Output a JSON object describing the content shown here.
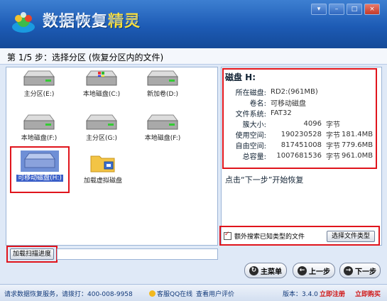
{
  "app": {
    "title_main": "数据恢复",
    "title_highlight": "精灵",
    "window_buttons": [
      "▾",
      "–",
      "□",
      "×"
    ]
  },
  "step": {
    "text": "第 1/5 步：选择分区 (恢复分区内的文件)"
  },
  "drives": [
    {
      "label": "主分区(E:)",
      "selected": false
    },
    {
      "label": "本地磁盘(C:)",
      "selected": false
    },
    {
      "label": "新加卷(D:)",
      "selected": false
    },
    {
      "label": "本地磁盘(F:)",
      "selected": false
    },
    {
      "label": "主分区(G:)",
      "selected": false
    },
    {
      "label": "本地磁盘(F:)",
      "selected": false
    },
    {
      "label": "可移动磁盘(H:)",
      "selected": true
    },
    {
      "label": "加载虚拟磁盘",
      "selected": false
    }
  ],
  "left": {
    "load_scan_btn": "加载扫描进度"
  },
  "disk": {
    "title": "磁盘 H:",
    "rows": [
      {
        "k": "所在磁盘:",
        "v": "RD2:(961MB)",
        "u": "",
        "v2": ""
      },
      {
        "k": "卷名:",
        "v": "可移动磁盘",
        "u": "",
        "v2": ""
      },
      {
        "k": "文件系统:",
        "v": "FAT32",
        "u": "",
        "v2": ""
      },
      {
        "k": "簇大小:",
        "v": "4096",
        "u": "字节",
        "v2": ""
      },
      {
        "k": "使用空间:",
        "v": "190230528",
        "u": "字节",
        "v2": "181.4MB"
      },
      {
        "k": "自由空间:",
        "v": "817451008",
        "u": "字节",
        "v2": "779.6MB"
      },
      {
        "k": "总容量:",
        "v": "1007681536",
        "u": "字节",
        "v2": "961.0MB"
      }
    ],
    "hint": "点击“下一步”开始恢复",
    "extra_search": "额外搜索已知类型的文件",
    "select_type_btn": "选择文件类型"
  },
  "nav": {
    "menu": "主菜单",
    "prev": "上一步",
    "next": "下一步"
  },
  "footer": {
    "service": "请求数据恢复服务，请拨打：400-008-9958",
    "qq": "客服QQ在线",
    "review": "查看用户评价",
    "version": "版本：3.4.0",
    "register": "立即注册",
    "buy": "立即购买"
  },
  "colors": {
    "accent": "#1d5bb5",
    "highlight": "#e0141c",
    "brand_yellow": "#ffe23a"
  }
}
